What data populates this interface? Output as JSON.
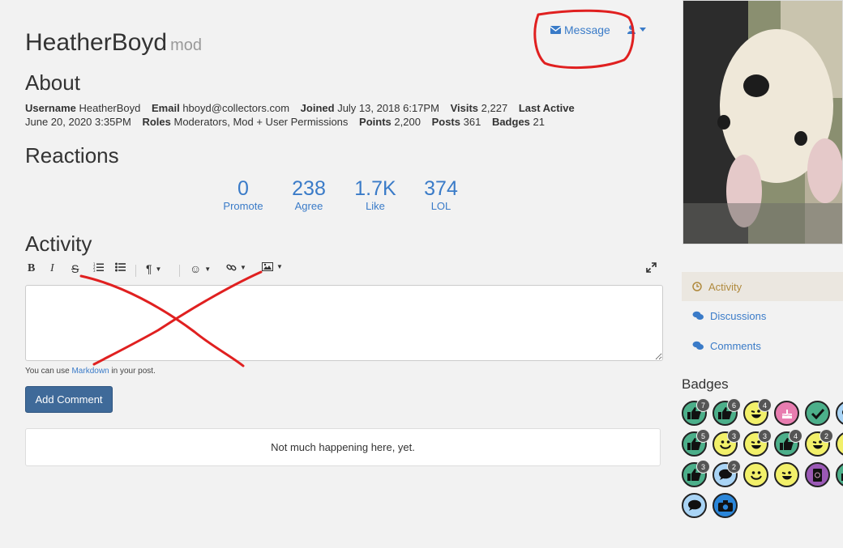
{
  "header": {
    "breadcrumb_fragment": "› ... ›",
    "name": "HeatherBoyd",
    "role_tag": "mod",
    "message_label": "Message"
  },
  "about": {
    "heading": "About",
    "username_label": "Username",
    "username": "HeatherBoyd",
    "email_label": "Email",
    "email": "hboyd@collectors.com",
    "joined_label": "Joined",
    "joined": "July 13, 2018 6:17PM",
    "visits_label": "Visits",
    "visits": "2,227",
    "last_active_label": "Last Active",
    "last_active": "June 20, 2020 3:35PM",
    "roles_label": "Roles",
    "roles": "Moderators, Mod + User Permissions",
    "points_label": "Points",
    "points": "2,200",
    "posts_label": "Posts",
    "posts": "361",
    "badges_label": "Badges",
    "badges": "21"
  },
  "reactions": {
    "heading": "Reactions",
    "items": [
      {
        "value": "0",
        "label": "Promote"
      },
      {
        "value": "238",
        "label": "Agree"
      },
      {
        "value": "1.7K",
        "label": "Like"
      },
      {
        "value": "374",
        "label": "LOL"
      }
    ]
  },
  "activity": {
    "heading": "Activity",
    "toolbar": {
      "bold": "B",
      "italic": "I",
      "strike": "S",
      "paragraph": "¶",
      "emoji": "☺",
      "link": "🔗",
      "image": "image-icon"
    },
    "hint_prefix": "You can use ",
    "hint_link": "Markdown",
    "hint_suffix": " in your post.",
    "add_comment": "Add Comment",
    "empty_message": "Not much happening here, yet."
  },
  "sidebar": {
    "nav": [
      {
        "label": "Activity",
        "icon": "clock-icon",
        "active": true
      },
      {
        "label": "Discussions",
        "icon": "discussions-icon",
        "active": false
      },
      {
        "label": "Comments",
        "icon": "comments-icon",
        "active": false
      }
    ],
    "badges_heading": "Badges",
    "badges": [
      {
        "icon": "thumbs-up-icon",
        "color": "#4caf8a",
        "count": "7"
      },
      {
        "icon": "thumbs-up-icon",
        "color": "#4caf8a",
        "count": "6"
      },
      {
        "icon": "wink-face-icon",
        "color": "#f2f06a",
        "count": "4"
      },
      {
        "icon": "cake-icon",
        "color": "#e87db0",
        "count": ""
      },
      {
        "icon": "check-icon",
        "color": "#4caf8a",
        "count": ""
      },
      {
        "icon": "comment-icon",
        "color": "#a9d4f5",
        "count": ""
      },
      {
        "icon": "thumbs-up-icon",
        "color": "#4caf8a",
        "count": "5"
      },
      {
        "icon": "smile-face-icon",
        "color": "#f2f06a",
        "count": "3"
      },
      {
        "icon": "wink-face-icon",
        "color": "#f2f06a",
        "count": "3"
      },
      {
        "icon": "thumbs-up-icon",
        "color": "#4caf8a",
        "count": "4"
      },
      {
        "icon": "wink-face-icon",
        "color": "#f2f06a",
        "count": "2"
      },
      {
        "icon": "smile-face-icon",
        "color": "#f2f06a",
        "count": ""
      },
      {
        "icon": "thumbs-up-icon",
        "color": "#4caf8a",
        "count": "3"
      },
      {
        "icon": "comment-icon",
        "color": "#a9d4f5",
        "count": "2"
      },
      {
        "icon": "smile-face-icon",
        "color": "#f2f06a",
        "count": ""
      },
      {
        "icon": "wink-face-icon",
        "color": "#f2f06a",
        "count": ""
      },
      {
        "icon": "address-book-icon",
        "color": "#9b59b6",
        "count": ""
      },
      {
        "icon": "thumbs-up-icon",
        "color": "#4caf8a",
        "count": ""
      },
      {
        "icon": "comment-icon",
        "color": "#a9d4f5",
        "count": ""
      },
      {
        "icon": "camera-icon",
        "color": "#2b86d9",
        "count": ""
      }
    ]
  },
  "colors": {
    "link": "#3a7bc8",
    "button": "#3f6a99",
    "active_nav_bg": "#ebe7e0",
    "active_nav_text": "#b08a3e",
    "annotation_ink": "#e02020"
  }
}
